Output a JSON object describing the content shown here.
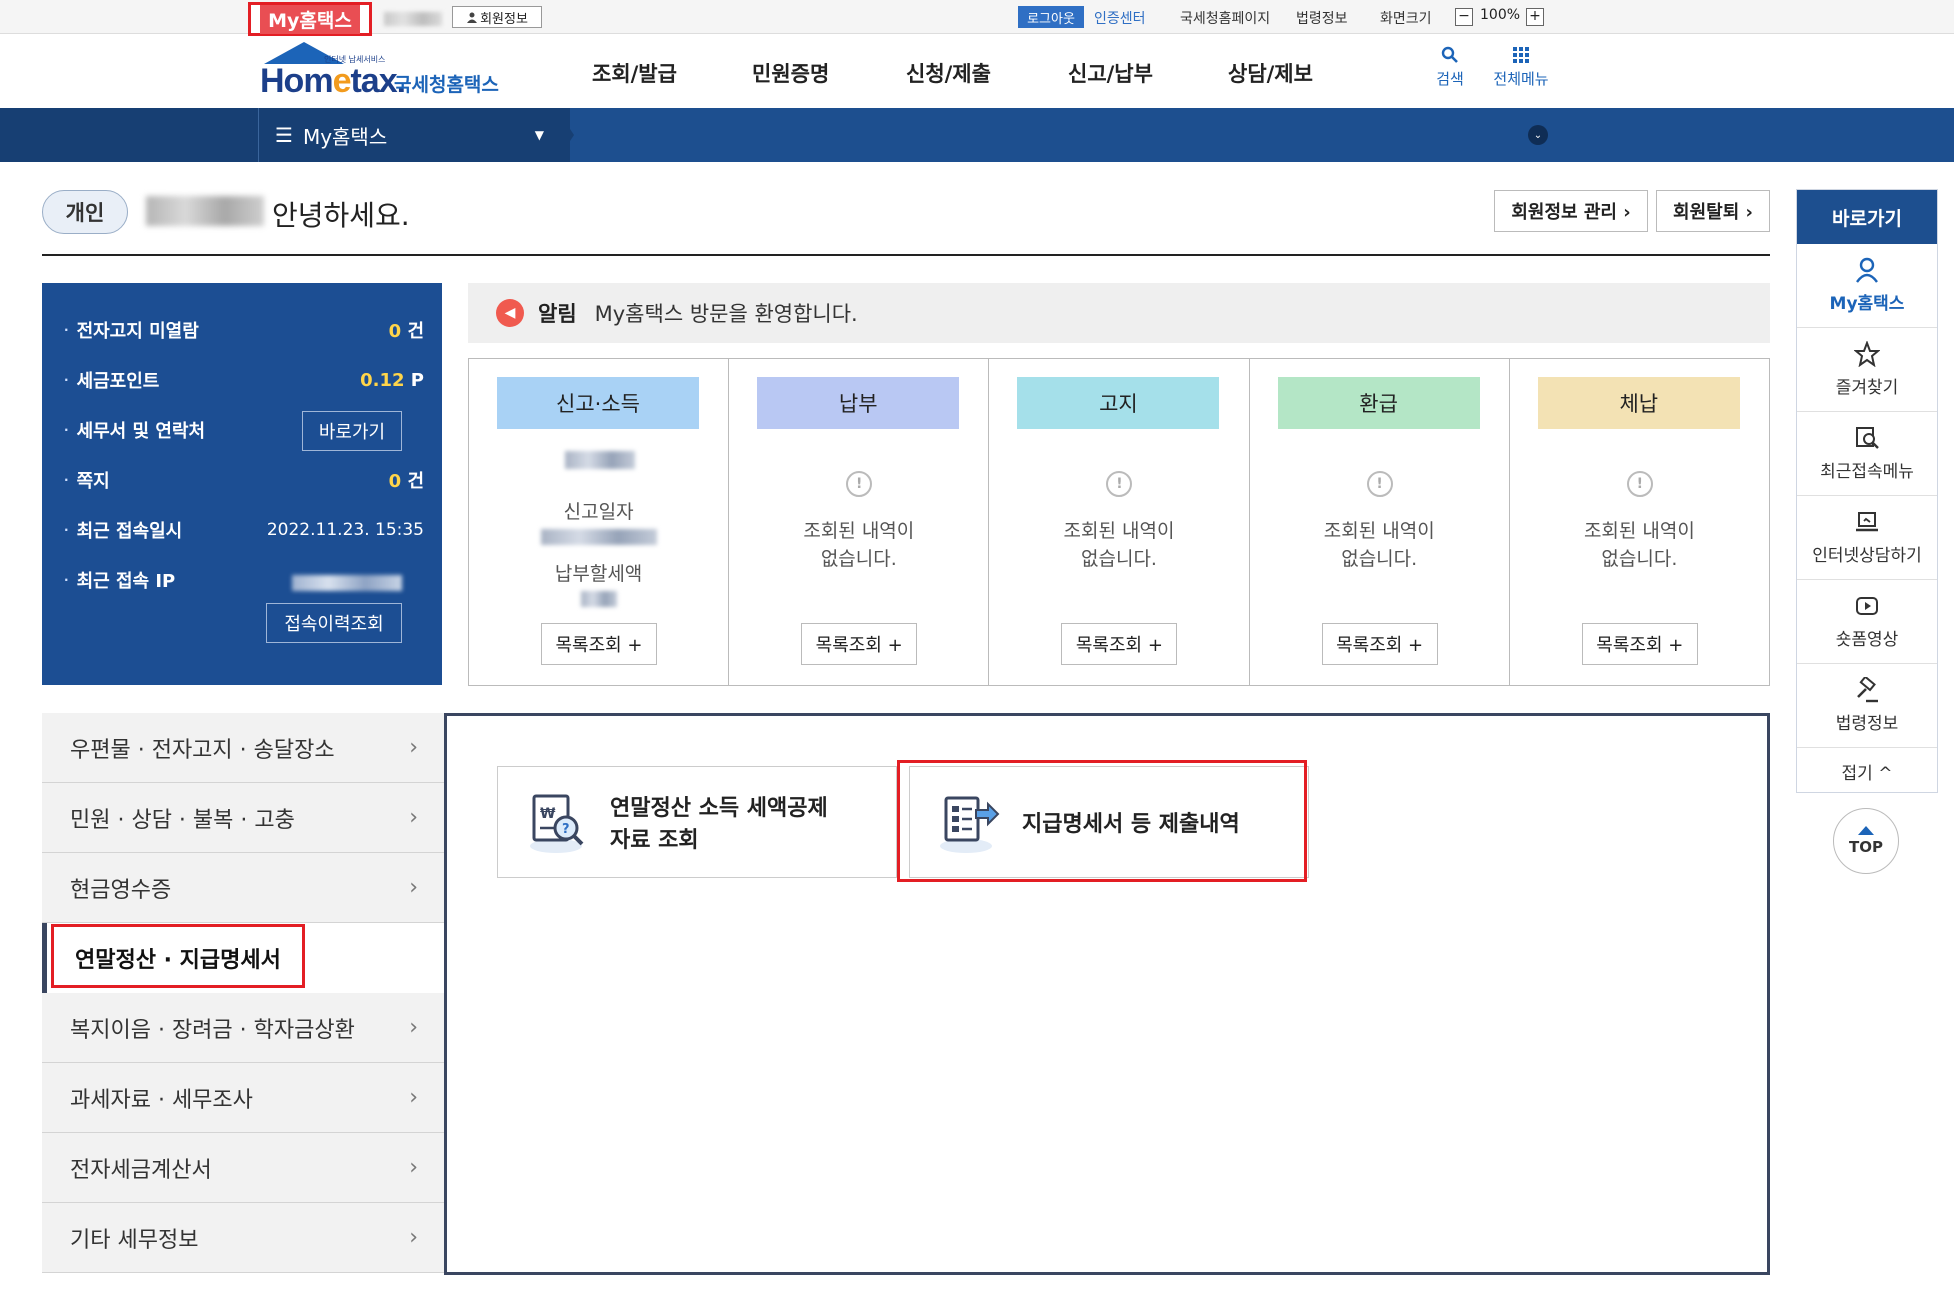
{
  "topbar": {
    "my_hometax": "My홈택스",
    "member_info": "회원정보",
    "logout": "로그아웃",
    "cert_center": "인증센터",
    "nts_homepage": "국세청홈페이지",
    "law_info": "법령정보",
    "screen_size": "화면크기",
    "zoom": "100%",
    "zoom_minus": "−",
    "zoom_plus": "+"
  },
  "header": {
    "logo_tag": "인터넷 납세서비스",
    "logo_home": "Hom",
    "logo_e": "e",
    "logo_tax": "tax.",
    "logo_nts": "국세청홈택스",
    "nav": [
      "조회/발급",
      "민원증명",
      "신청/제출",
      "신고/납부",
      "상담/제보"
    ],
    "search": "검색",
    "all_menu": "전체메뉴"
  },
  "navband": {
    "menu": "My홈택스"
  },
  "greeting": {
    "user_type": "개인",
    "text": "안녕하세요.",
    "manage_member": "회원정보 관리 ›",
    "withdraw": "회원탈퇴 ›"
  },
  "summary": {
    "e_notice_label": "전자고지 미열람",
    "e_notice_count": "0",
    "e_notice_unit": "건",
    "tax_point_label": "세금포인트",
    "tax_point_value": "0.12",
    "tax_point_unit": "P",
    "tax_office_label": "세무서 및 연락처",
    "tax_office_btn": "바로가기",
    "memo_label": "쪽지",
    "memo_count": "0",
    "memo_unit": "건",
    "last_access_label": "최근 접속일시",
    "last_access_value": "2022.11.23.  15:35",
    "last_ip_label": "최근 접속 IP",
    "access_history_btn": "접속이력조회"
  },
  "notice": {
    "label": "알림",
    "text": "My홈택스 방문을 환영합니다."
  },
  "cards": [
    {
      "title": "신고·소득",
      "color": "#a9d2f5",
      "line1": "신고일자",
      "line2": "납부할세액",
      "button": "목록조회 +"
    },
    {
      "title": "납부",
      "color": "#b9c8f3",
      "empty": "조회된 내역이",
      "empty2": "없습니다.",
      "button": "목록조회 +"
    },
    {
      "title": "고지",
      "color": "#a5e0ea",
      "empty": "조회된 내역이",
      "empty2": "없습니다.",
      "button": "목록조회 +"
    },
    {
      "title": "환급",
      "color": "#b4e6c6",
      "empty": "조회된 내역이",
      "empty2": "없습니다.",
      "button": "목록조회 +"
    },
    {
      "title": "체납",
      "color": "#f3e2b4",
      "empty": "조회된 내역이",
      "empty2": "없습니다.",
      "button": "목록조회 +"
    }
  ],
  "left_menu": [
    "우편물 · 전자고지 · 송달장소",
    "민원 · 상담 · 불복 · 고충",
    "현금영수증",
    "연말정산 · 지급명세서",
    "복지이음 · 장려금 · 학자금상환",
    "과세자료 · 세무조사",
    "전자세금계산서",
    "기타 세무정보"
  ],
  "services": {
    "svc1_line1": "연말정산 소득 세액공제",
    "svc1_line2": "자료 조회",
    "svc2": "지급명세서 등 제출내역"
  },
  "quick": {
    "title": "바로가기",
    "items": [
      "My홈택스",
      "즐겨찾기",
      "최근접속메뉴",
      "인터넷상담하기",
      "숏폼영상",
      "법령정보"
    ],
    "fold": "접기 ^",
    "top": "TOP"
  },
  "colors": {
    "navy": "#1c4e93",
    "highlight": "#e31e24",
    "accent": "#1c64b8"
  }
}
